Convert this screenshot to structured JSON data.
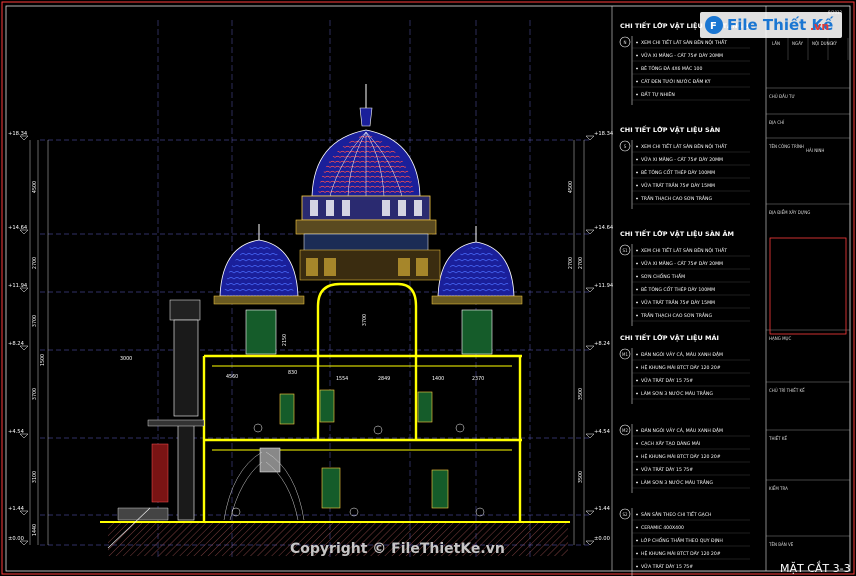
{
  "logo": {
    "brand": "File Thiết Kế",
    "domain": ".vn"
  },
  "watermark": "Copyright © FileThietKe.vn",
  "drawing_title": "MẶT CẮT 3-3",
  "levels_left": [
    "+18.34",
    "+14.64",
    "+11.94",
    "+8.24",
    "+4.54",
    "+1.44",
    "±0.00"
  ],
  "levels_right": [
    "+18.34",
    "+14.64",
    "+11.94",
    "+8.24",
    "+4.54",
    "+1.44",
    "±0.00"
  ],
  "dims_left": [
    "4500",
    "2700",
    "3700",
    "3700",
    "3100",
    "1440"
  ],
  "dims_inner": [
    "2700",
    "3500",
    "3500"
  ],
  "dims_mid": [
    "4500",
    "2700",
    "2150",
    "3700",
    "1500"
  ],
  "room_dims": [
    "4560",
    "830",
    "1554",
    "2849",
    "1400",
    "2370",
    "3000"
  ],
  "legends": [
    {
      "marker": "N",
      "title": "CHI TIẾT LỚP VẬT LIỆU NỀN TẦNG 1",
      "items": [
        "XEM CHI TIẾT LÁT SÀN BÊN NỘI THẤT",
        "VỮA XI MĂNG - CÁT 75# DÀY 20MM",
        "BÊ TÔNG ĐÁ 4X6 MÁC 100",
        "CÁT ĐEN TƯỚI NƯỚC ĐẦM KỸ",
        "ĐẤT TỰ NHIÊN"
      ]
    },
    {
      "marker": "S",
      "title": "CHI TIẾT LỚP VẬT LIỆU SÀN",
      "items": [
        "XEM CHI TIẾT LÁT SÀN BÊN NỘI THẤT",
        "VỮA XI MĂNG - CÁT 75# DÀY 20MM",
        "BÊ TÔNG CỐT THÉP DÀY 100MM",
        "VỮA TRÁT TRẦN 75# DÀY 15MM",
        "TRẦN THẠCH CAO SƠN TRẮNG"
      ]
    },
    {
      "marker": "S1",
      "title": "CHI TIẾT LỚP VẬT LIỆU SÀN ÂM",
      "items": [
        "XEM CHI TIẾT LÁT SÀN BÊN NỘI THẤT",
        "VỮA XI MĂNG - CÁT 75# DÀY 20MM",
        "SƠN CHỐNG THẤM",
        "BÊ TÔNG CỐT THÉP DÀY 100MM",
        "VỮA TRÁT TRẦN 75# DÀY 15MM",
        "TRẦN THẠCH CAO SƠN TRẮNG"
      ]
    },
    {
      "marker": "M1",
      "title": "CHI TIẾT LỚP VẬT LIỆU MÁI",
      "items": [
        "ĐÁN NGÓI VẢY CÁ, MÀU XANH ĐẬM",
        "HỆ KHUNG MÁI BTCT DÀY 120 20#",
        "VỮA TRÁT DÀY 15 75#",
        "LÀM SƠN 3 NƯỚC MÀU TRẮNG"
      ]
    },
    {
      "marker": "M2",
      "title": "",
      "items": [
        "ĐÁN NGÓI VẢY CÁ, MÀU XANH ĐẬM",
        "CẠCH XÂY TẠO DÁNG MÁI",
        "HỆ KHUNG MÁI BTCT DÀY 120 20#",
        "VỮA TRÁT DÀY 15 75#",
        "LÀM SƠN 3 NƯỚC MÀU TRẮNG"
      ]
    },
    {
      "marker": "S2",
      "title": "",
      "items": [
        "SÀN SÂN THEO CHI TIẾT GẠCH",
        "CERAMIC 400X400",
        "LỚP CHỐNG THẤM THEO QUY ĐỊNH",
        "HỆ KHUNG MÁI BTCT DÀY 120 20#",
        "VỮA TRÁT DÀY 15 75#"
      ]
    }
  ],
  "titleblock": {
    "header": [
      "LẦN",
      "NGÀY",
      "NỘI DUNG",
      "KÝ"
    ],
    "date": "8/2012",
    "rows": [
      "CHỦ ĐẦU TƯ",
      "ĐỊA CHỈ",
      "TÊN CÔNG TRÌNH",
      "ĐỊA ĐIỂM XÂY DỰNG",
      "HẠNG MỤC",
      "CHỦ TRÌ THIẾT KẾ",
      "THIẾT KẾ",
      "KIỂM TRA",
      "TÊN BẢN VẼ"
    ],
    "address_value": "HẢI NINH"
  },
  "colors": {
    "background": "#000000",
    "dome": "#1a1f9a",
    "dome_red": "#c4102a",
    "slab": "#ffff00",
    "frame": "#ff3b3b",
    "grid": "#8a8aff"
  }
}
